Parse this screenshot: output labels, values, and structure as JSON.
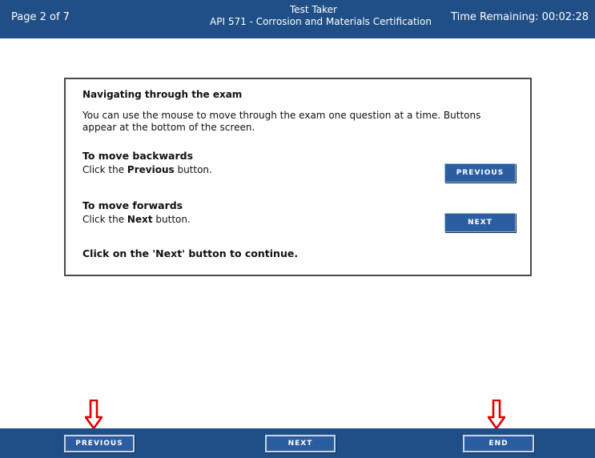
{
  "header": {
    "page_indicator": "Page 2 of 7",
    "test_taker": "Test Taker",
    "exam_title": "API 571 - Corrosion and Materials Certification",
    "time_remaining": "Time Remaining: 00:02:28"
  },
  "panel": {
    "heading": "Navigating through the exam",
    "intro": "You can use the mouse to move through the exam one question at a time. Buttons appear at the bottom of the screen.",
    "backwards_title": "To move backwards",
    "backwards_pre": "Click the ",
    "backwards_bold": "Previous",
    "backwards_post": " button.",
    "forwards_title": "To move forwards",
    "forwards_pre": "Click the ",
    "forwards_bold": "Next",
    "forwards_post": " button.",
    "example_previous_label": "Previous",
    "example_next_label": "Next",
    "continue_text": "Click on the 'Next' button to continue."
  },
  "footer": {
    "previous_label": "Previous",
    "next_label": "Next",
    "end_label": "End"
  },
  "colors": {
    "bar": "#1f4f86",
    "button": "#2a5ea0",
    "arrow": "#e00000"
  },
  "icons": {
    "pointer_arrows": "down-arrow-icon"
  }
}
